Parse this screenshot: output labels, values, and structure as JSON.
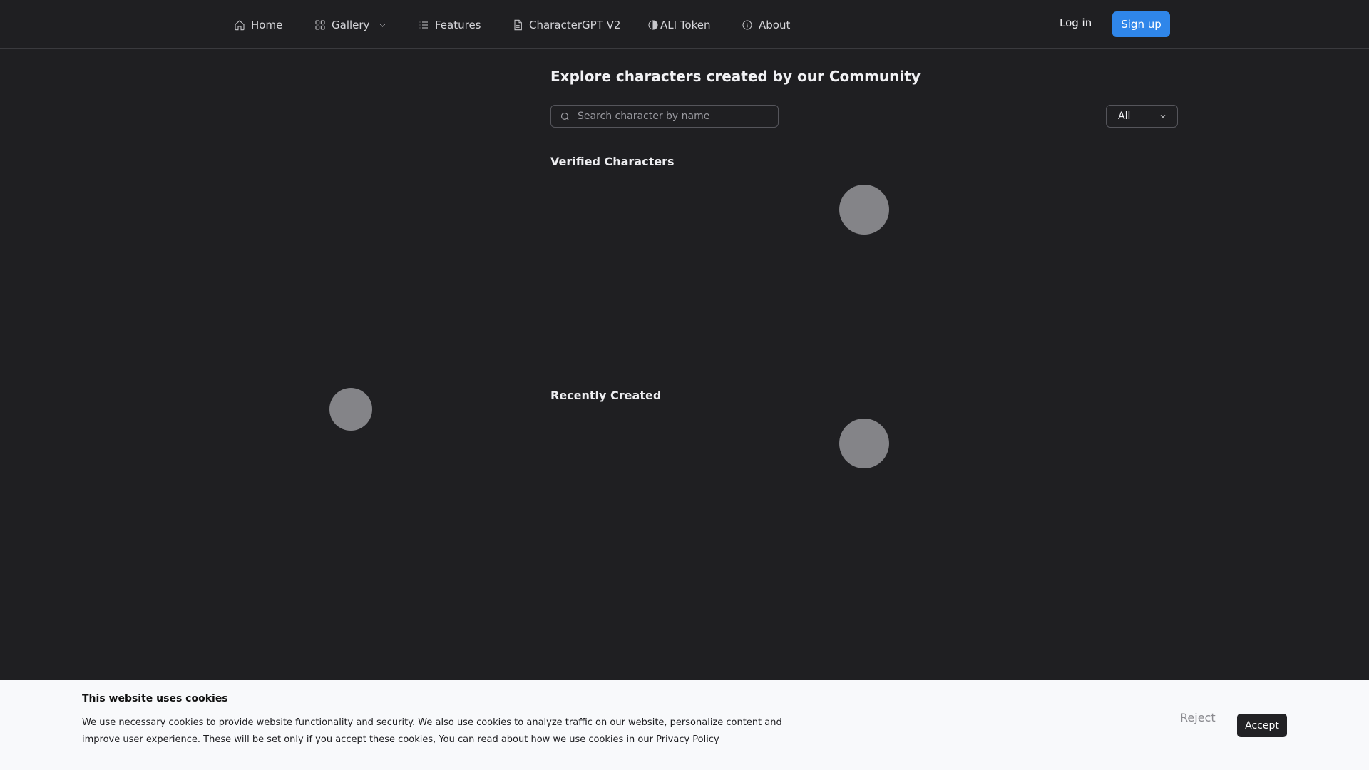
{
  "nav": {
    "items": [
      {
        "label": "Home",
        "icon": "home-icon"
      },
      {
        "label": "Gallery",
        "icon": "grid-icon"
      },
      {
        "label": "Features",
        "icon": "list-icon"
      },
      {
        "label": "CharacterGPT V2",
        "icon": "document-icon"
      },
      {
        "label": "ALI Token",
        "icon": "half-circle-icon"
      },
      {
        "label": "About",
        "icon": "info-icon"
      }
    ],
    "login_label": "Log in",
    "signup_label": "Sign up"
  },
  "main": {
    "title": "Explore characters created by our Community",
    "search_placeholder": "Search character by name",
    "filter_value": "All",
    "sections": {
      "verified": "Verified Characters",
      "recent": "Recently Created"
    }
  },
  "cookie": {
    "title": "This website uses cookies",
    "text": "We use necessary cookies to provide website functionality and security. We also use cookies to analyze traffic on our website, personalize content and improve user experience. These will be set only if you accept these cookies, You can read about how we use cookies in our Privacy Policy",
    "reject_label": "Reject",
    "accept_label": "Accept"
  },
  "colors": {
    "background": "#1f1f22",
    "accent": "#2f86ea",
    "spinner": "#848488"
  }
}
